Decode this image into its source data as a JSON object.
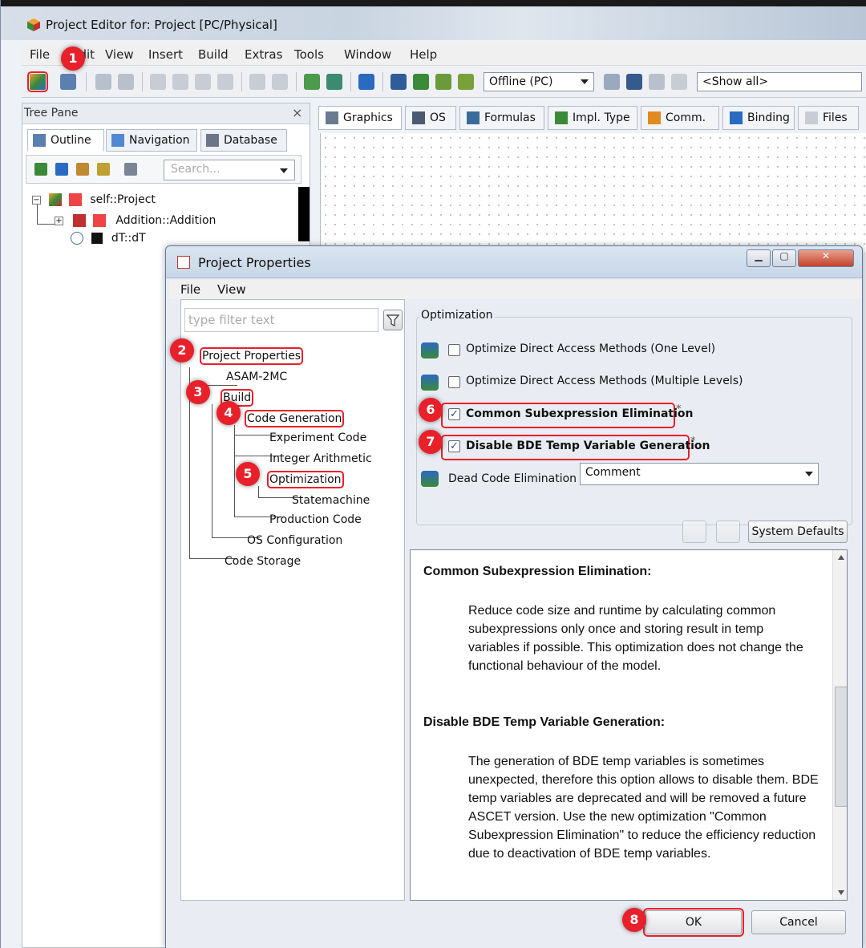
{
  "window": {
    "title": "Project Editor for: Project [PC/Physical]"
  },
  "menu": [
    "File",
    "Edit",
    "View",
    "Insert",
    "Build",
    "Extras",
    "Tools",
    "Window",
    "Help"
  ],
  "toolbar": {
    "target": "Offline (PC)",
    "filter": "<Show all>"
  },
  "tree_pane": {
    "title": "Tree Pane",
    "close": "×",
    "tabs": [
      "Outline",
      "Navigation",
      "Database"
    ],
    "search_placeholder": "Search...",
    "items": [
      "self::Project",
      "Addition::Addition",
      "dT::dT"
    ]
  },
  "editor_tabs": [
    "Graphics",
    "OS",
    "Formulas",
    "Impl. Type",
    "Comm.",
    "Binding",
    "Files"
  ],
  "dialog": {
    "title": "Project Properties",
    "menu": [
      "File",
      "View"
    ],
    "filter_placeholder": "type filter text",
    "nav": [
      "Project Properties",
      "ASAM-2MC",
      "Build",
      "Code Generation",
      "Experiment Code",
      "Integer Arithmetic",
      "Optimization",
      "Statemachine",
      "Production Code",
      "OS Configuration",
      "Code Storage"
    ],
    "section_title": "Optimization",
    "options": [
      {
        "label": "Optimize Direct Access Methods (One Level)",
        "checked": false
      },
      {
        "label": "Optimize Direct Access Methods (Multiple Levels)",
        "checked": false
      },
      {
        "label": "Common Subexpression Elimination",
        "checked": true
      },
      {
        "label": "Disable BDE Temp Variable Generation",
        "checked": true
      }
    ],
    "modified_mark": "*",
    "dead_code_label": "Dead Code Elimination",
    "dead_code_value": "Comment",
    "system_defaults": "System Defaults",
    "help": [
      {
        "title": "Common Subexpression Elimination:",
        "text": "Reduce code size and runtime by calculating common subexpressions only once and storing result in temp variables if possible. This optimization does not change the functional behaviour of the model."
      },
      {
        "title": "Disable BDE Temp Variable Generation:",
        "text": "The generation of BDE temp variables is sometimes unexpected, therefore this option allows to disable them. BDE temp variables are deprecated and will be removed a future ASCET version. Use the new optimization \"Common Subexpression Elimination\" to reduce the efficiency reduction due to deactivation of BDE temp variables."
      }
    ],
    "ok": "OK",
    "cancel": "Cancel"
  },
  "badges": [
    "1",
    "2",
    "3",
    "4",
    "5",
    "6",
    "7",
    "8"
  ],
  "colors": {
    "annotation_red": "#e8202a",
    "accent_blue": "#1b4fa8"
  }
}
